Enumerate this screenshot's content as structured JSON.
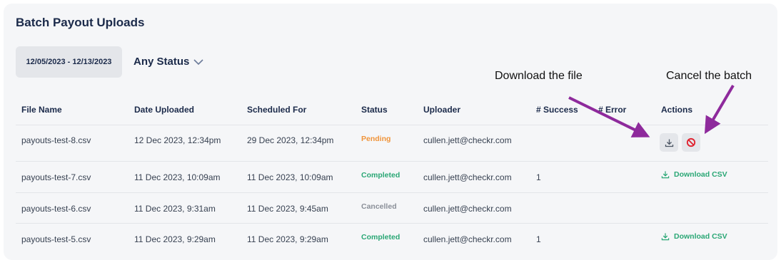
{
  "page": {
    "title": "Batch Payout Uploads"
  },
  "filters": {
    "date_range": "12/05/2023 - 12/13/2023",
    "status_select": "Any Status"
  },
  "annotations": {
    "download": "Download the file",
    "cancel": "Cancel the batch"
  },
  "table": {
    "headers": [
      "File Name",
      "Date Uploaded",
      "Scheduled For",
      "Status",
      "Uploader",
      "# Success",
      "# Error",
      "Actions"
    ],
    "rows": [
      {
        "file": "payouts-test-8.csv",
        "uploaded": "12 Dec 2023, 12:34pm",
        "scheduled": "29 Dec 2023, 12:34pm",
        "status": "Pending",
        "uploader": "cullen.jett@checkr.com",
        "success": "",
        "error": ""
      },
      {
        "file": "payouts-test-7.csv",
        "uploaded": "11 Dec 2023, 10:09am",
        "scheduled": "11 Dec 2023, 10:09am",
        "status": "Completed",
        "uploader": "cullen.jett@checkr.com",
        "success": "1",
        "error": "",
        "action": "Download CSV"
      },
      {
        "file": "payouts-test-6.csv",
        "uploaded": "11 Dec 2023, 9:31am",
        "scheduled": "11 Dec 2023, 9:45am",
        "status": "Cancelled",
        "uploader": "cullen.jett@checkr.com",
        "success": "",
        "error": ""
      },
      {
        "file": "payouts-test-5.csv",
        "uploaded": "11 Dec 2023, 9:29am",
        "scheduled": "11 Dec 2023, 9:29am",
        "status": "Completed",
        "uploader": "cullen.jett@checkr.com",
        "success": "1",
        "error": "",
        "action": "Download CSV"
      }
    ]
  },
  "colors": {
    "pending": "#f0943a",
    "completed": "#2aa775",
    "cancelled": "#8a8f98",
    "cancel_icon": "#e0202e",
    "arrow": "#8e2a9c"
  }
}
